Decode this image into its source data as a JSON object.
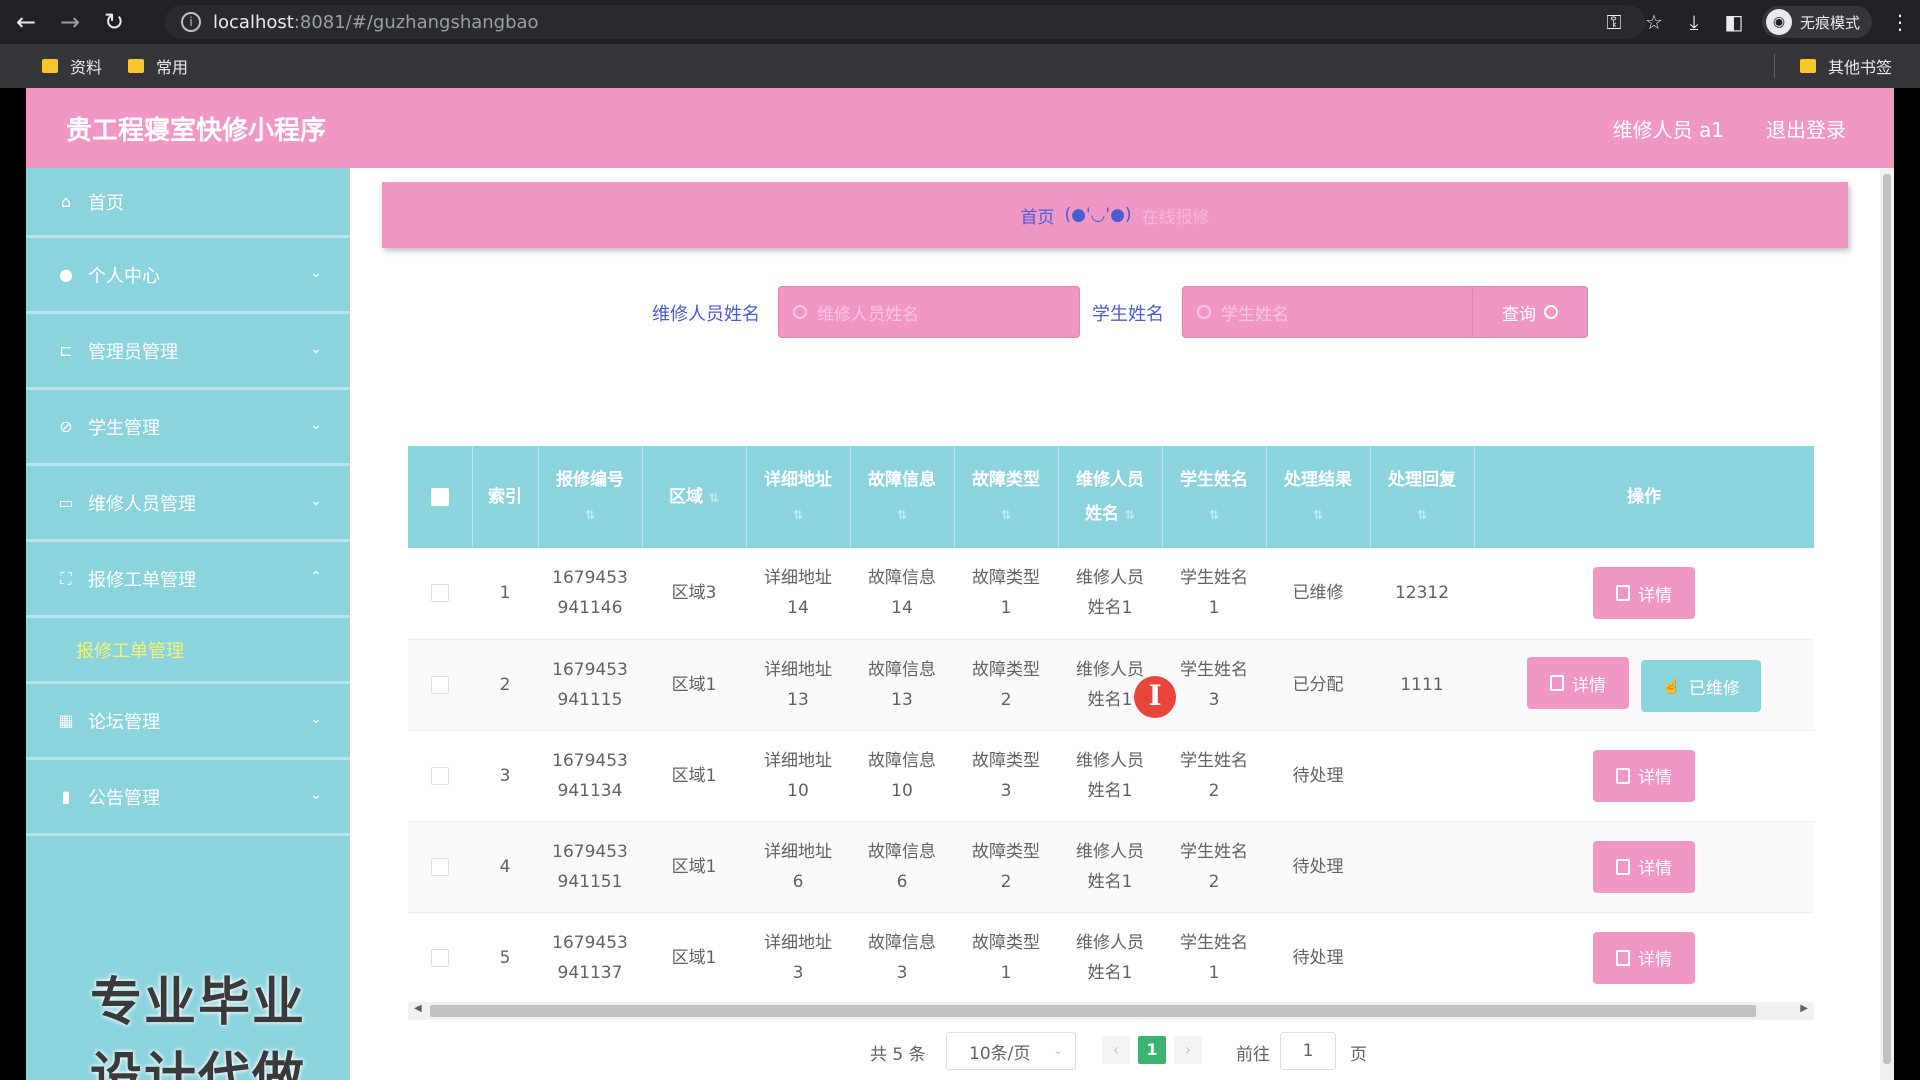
{
  "browser": {
    "url_host": "localhost",
    "url_path": ":8081/#/guzhangshangbao",
    "incognito_label": "无痕模式",
    "bookmarks": [
      "资料",
      "常用"
    ],
    "other_bookmarks": "其他书签"
  },
  "header": {
    "brand": "贵工程寝室快修小程序",
    "user": "维修人员 a1",
    "logout": "退出登录"
  },
  "sidebar": {
    "items": [
      {
        "label": "首页",
        "icon": "home-icon"
      },
      {
        "label": "个人中心",
        "icon": "user-icon"
      },
      {
        "label": "管理员管理",
        "icon": "crop-icon"
      },
      {
        "label": "学生管理",
        "icon": "student-icon"
      },
      {
        "label": "维修人员管理",
        "icon": "card-icon"
      },
      {
        "label": "报修工单管理",
        "icon": "expand-icon"
      },
      {
        "label": "论坛管理",
        "icon": "grid-icon"
      },
      {
        "label": "公告管理",
        "icon": "chart-icon"
      }
    ],
    "submenu_active": "报修工单管理",
    "watermark": "专业毕业设计代做"
  },
  "breadcrumb": {
    "home": "首页",
    "face": "(●'◡'●)",
    "current": "在线报修"
  },
  "search": {
    "repair_label": "维修人员姓名",
    "repair_placeholder": "维修人员姓名",
    "student_label": "学生姓名",
    "student_placeholder": "学生姓名",
    "query_button": "查询"
  },
  "table": {
    "headers": {
      "index": "索引",
      "code": "报修编号",
      "area": "区域",
      "address": "详细地址",
      "fault_info": "故障信息",
      "fault_type": "故障类型",
      "repairer": "维修人员姓名",
      "student": "学生姓名",
      "result": "处理结果",
      "reply": "处理回复",
      "ops": "操作"
    },
    "rows": [
      {
        "index": "1",
        "code": "1679453941146",
        "area": "区域3",
        "address": "详细地址14",
        "fault_info": "故障信息14",
        "fault_type": "故障类型1",
        "repairer": "维修人员姓名1",
        "student": "学生姓名1",
        "result": "已维修",
        "reply": "12312"
      },
      {
        "index": "2",
        "code": "1679453941115",
        "area": "区域1",
        "address": "详细地址13",
        "fault_info": "故障信息13",
        "fault_type": "故障类型2",
        "repairer": "维修人员姓名1",
        "student": "学生姓名3",
        "result": "已分配",
        "reply": "1111"
      },
      {
        "index": "3",
        "code": "1679453941134",
        "area": "区域1",
        "address": "详细地址10",
        "fault_info": "故障信息10",
        "fault_type": "故障类型3",
        "repairer": "维修人员姓名1",
        "student": "学生姓名2",
        "result": "待处理",
        "reply": ""
      },
      {
        "index": "4",
        "code": "1679453941151",
        "area": "区域1",
        "address": "详细地址6",
        "fault_info": "故障信息6",
        "fault_type": "故障类型2",
        "repairer": "维修人员姓名1",
        "student": "学生姓名2",
        "result": "待处理",
        "reply": ""
      },
      {
        "index": "5",
        "code": "1679453941137",
        "area": "区域1",
        "address": "详细地址3",
        "fault_info": "故障信息3",
        "fault_type": "故障类型1",
        "repairer": "维修人员姓名1",
        "student": "学生姓名1",
        "result": "待处理",
        "reply": ""
      }
    ],
    "detail_button": "详情",
    "repaired_button": "已维修"
  },
  "pagination": {
    "total": "共 5 条",
    "page_size": "10条/页",
    "current_page": "1",
    "goto_label": "前往",
    "goto_value": "1",
    "goto_unit": "页"
  },
  "colors": {
    "pink": "#f097c5",
    "teal": "#8bd3dd",
    "highlight": "#f2f46f"
  }
}
